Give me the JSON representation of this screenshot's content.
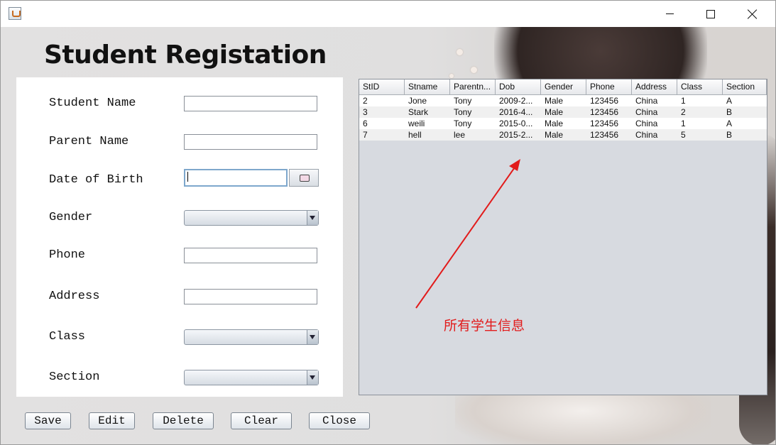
{
  "window": {
    "app_icon": "java-cup-icon",
    "title": ""
  },
  "heading": "Student Registation",
  "form": {
    "student_name_label": "Student Name",
    "parent_name_label": "Parent Name",
    "dob_label": "Date of Birth",
    "gender_label": "Gender",
    "phone_label": "Phone",
    "address_label": "Address",
    "class_label": "Class",
    "section_label": "Section",
    "student_name": "",
    "parent_name": "",
    "dob": "",
    "gender": "",
    "phone": "",
    "address": "",
    "class": "",
    "section": ""
  },
  "buttons": {
    "save": "Save",
    "edit": "Edit",
    "delete": "Delete",
    "clear": "Clear",
    "close": "Close"
  },
  "table": {
    "columns": [
      "StID",
      "Stname",
      "Parentn...",
      "Dob",
      "Gender",
      "Phone",
      "Address",
      "Class",
      "Section"
    ],
    "rows": [
      [
        "2",
        "Jone",
        "Tony",
        "2009-2...",
        "Male",
        "123456",
        "China",
        "1",
        "A"
      ],
      [
        "3",
        "Stark",
        "Tony",
        "2016-4...",
        "Male",
        "123456",
        "China",
        "2",
        "B"
      ],
      [
        "6",
        "weili",
        "Tony",
        "2015-0...",
        "Male",
        "123456",
        "China",
        "1",
        "A"
      ],
      [
        "7",
        "hell",
        "lee",
        "2015-2...",
        "Male",
        "123456",
        "China",
        "5",
        "B"
      ]
    ]
  },
  "annotation": {
    "text": "所有学生信息",
    "color": "#e21b1b"
  }
}
